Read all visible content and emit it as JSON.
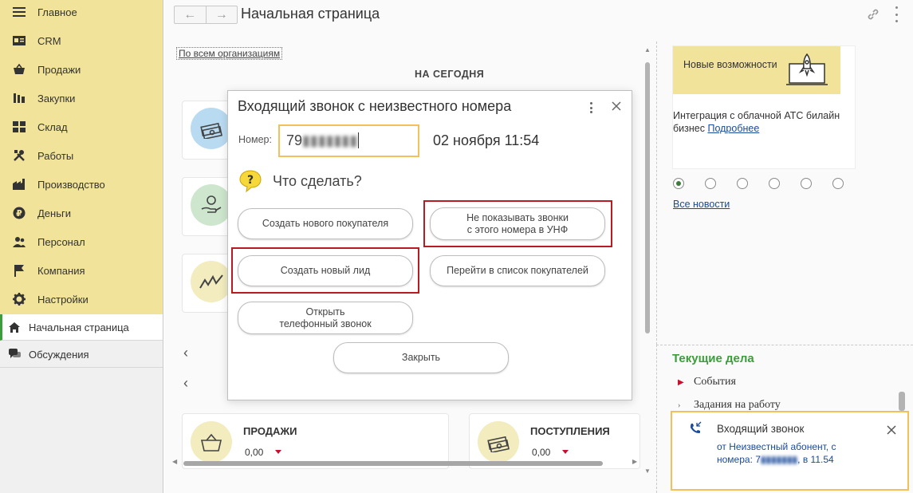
{
  "sidebar": {
    "items": [
      {
        "label": "Главное",
        "icon": "menu-icon"
      },
      {
        "label": "CRM",
        "icon": "crm-icon"
      },
      {
        "label": "Продажи",
        "icon": "basket-icon"
      },
      {
        "label": "Закупки",
        "icon": "purchases-icon"
      },
      {
        "label": "Склад",
        "icon": "warehouse-icon"
      },
      {
        "label": "Работы",
        "icon": "tools-icon"
      },
      {
        "label": "Производство",
        "icon": "factory-icon"
      },
      {
        "label": "Деньги",
        "icon": "ruble-icon"
      },
      {
        "label": "Персонал",
        "icon": "people-icon"
      },
      {
        "label": "Компания",
        "icon": "flag-icon"
      },
      {
        "label": "Настройки",
        "icon": "gear-icon"
      }
    ],
    "lower": [
      {
        "label": "Начальная страница",
        "icon": "home-icon",
        "active": true
      },
      {
        "label": "Обсуждения",
        "icon": "chat-icon",
        "active": false
      }
    ]
  },
  "header": {
    "title": "Начальная страница"
  },
  "main": {
    "org_link": "По всем организациям",
    "today_label": "НА СЕГОДНЯ",
    "sales_card": {
      "title": "ПРОДАЖИ",
      "value": "0,00"
    },
    "income_card": {
      "title": "ПОСТУПЛЕНИЯ",
      "value": "0,00"
    }
  },
  "news": {
    "promo_title": "Новые возможности",
    "promo_text": "Интеграция с облачной АТС билайн бизнес",
    "promo_link": "Подробнее",
    "all_news": "Все новости",
    "page_count": 6,
    "active_page": 0
  },
  "tasks": {
    "title": "Текущие дела",
    "items": [
      "События",
      "Задания на работу"
    ]
  },
  "dialog": {
    "title": "Входящий звонок с неизвестного номера",
    "number_label": "Номер:",
    "number_value": "79",
    "datetime": "02 ноября 11:54",
    "question": "Что сделать?",
    "btn_new_customer": "Создать нового покупателя",
    "btn_dont_show_1": "Не показывать звонки",
    "btn_dont_show_2": "с этого номера в УНФ",
    "btn_new_lead": "Создать новый лид",
    "btn_customer_list": "Перейти в список покупателей",
    "btn_open_call_1": "Открыть",
    "btn_open_call_2": "телефонный звонок",
    "btn_close": "Закрыть"
  },
  "toast": {
    "title": "Входящий звонок",
    "line1": "от Неизвестный абонент, с",
    "line2": "номера: 7",
    "line2_suffix": ", в 11.54"
  },
  "colors": {
    "sidebar_bg": "#f2e39a",
    "accent_green": "#3b9e3b",
    "highlight_red": "#b81c22",
    "input_border": "#f3c15b",
    "link_blue": "#1a4a9a"
  }
}
